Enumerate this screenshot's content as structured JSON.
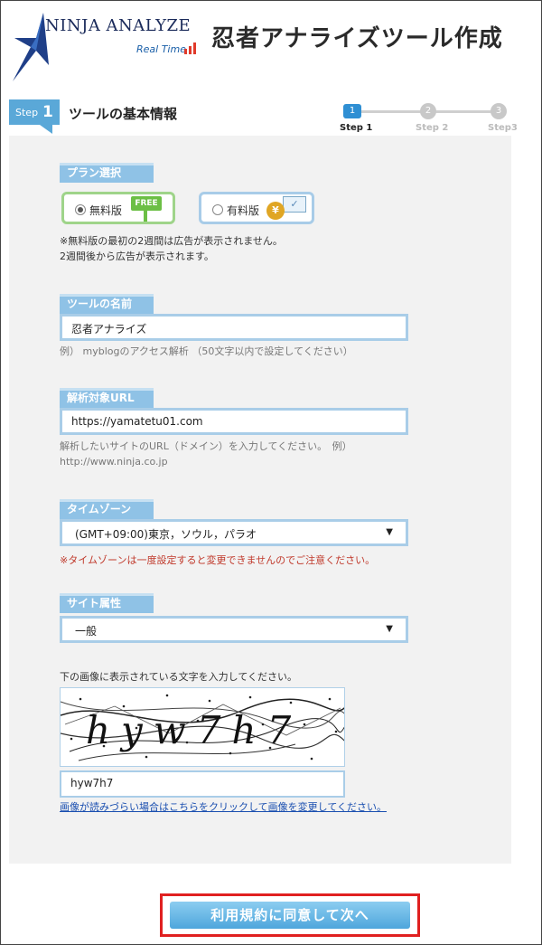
{
  "header": {
    "logo_text": "NINJA ANALYZE",
    "logo_sub": "Real Time",
    "title": "忍者アナライズツール作成"
  },
  "stepbar": {
    "tag_prefix": "Step",
    "tag_number": "1",
    "title": "ツールの基本情報",
    "steps": [
      {
        "num": "1",
        "label": "Step 1",
        "active": true
      },
      {
        "num": "2",
        "label": "Step 2",
        "active": false
      },
      {
        "num": "3",
        "label": "Step3",
        "active": false
      }
    ]
  },
  "plan": {
    "label": "プラン選択",
    "free_label": "無料版",
    "free_badge": "FREE",
    "paid_label": "有料版",
    "paid_badge": "¥",
    "selected": "free",
    "note_line1": "※無料版の最初の2週間は広告が表示されません。",
    "note_line2": "2週間後から広告が表示されます。"
  },
  "tool_name": {
    "label": "ツールの名前",
    "value": "忍者アナライズ",
    "hint": "例） myblogのアクセス解析 （50文字以内で設定してください）"
  },
  "target_url": {
    "label": "解析対象URL",
    "value": "https://yamatetu01.com",
    "hint_line1": "解析したいサイトのURL（ドメイン）を入力してください。　例）",
    "hint_line2": "http://www.ninja.co.jp"
  },
  "timezone": {
    "label": "タイムゾーン",
    "value": "(GMT+09:00)東京，ソウル，パラオ",
    "warning": "※タイムゾーンは一度設定すると変更できませんのでご注意ください。"
  },
  "site_attr": {
    "label": "サイト属性",
    "value": "一般"
  },
  "captcha": {
    "instruction": "下の画像に表示されている文字を入力してください。",
    "image_text": "hyw7h7",
    "value": "hyw7h7",
    "refresh_link": "画像が読みづらい場合はこちらをクリックして画像を変更してください。"
  },
  "submit": {
    "label": "利用規約に同意して次へ"
  },
  "colors": {
    "accent": "#5aa8d8",
    "section_label": "#8fc2e6",
    "warning": "#c0392b",
    "highlight_border": "#e02020"
  }
}
